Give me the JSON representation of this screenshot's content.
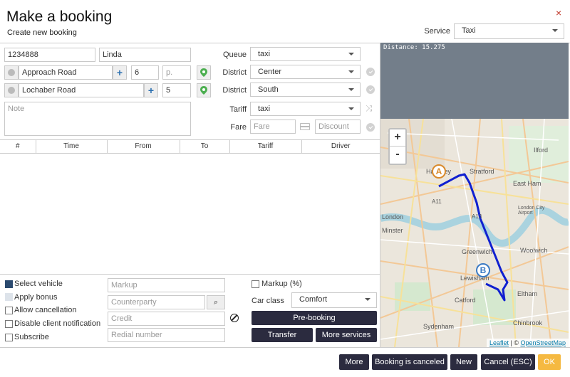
{
  "header": {
    "title": "Make a booking",
    "subtitle": "Create new booking",
    "close": "×"
  },
  "service": {
    "label": "Service",
    "value": "Taxi"
  },
  "client": {
    "phone": "1234888",
    "name": "Linda"
  },
  "pickup": {
    "street": "Approach Road",
    "house": "6",
    "apt_placeholder": "p."
  },
  "dropoff": {
    "street": "Lochaber Road",
    "house": "5"
  },
  "note_placeholder": "Note",
  "queue": {
    "label": "Queue",
    "value": "taxi"
  },
  "district1": {
    "label": "District",
    "value": "Center"
  },
  "district2": {
    "label": "District",
    "value": "South"
  },
  "tariff": {
    "label": "Tariff",
    "value": "taxi"
  },
  "fare": {
    "label": "Fare",
    "placeholder": "Fare",
    "discount_placeholder": "Discount"
  },
  "table": {
    "columns": [
      "#",
      "Time",
      "From",
      "To",
      "Tariff",
      "Driver"
    ]
  },
  "options": {
    "select_vehicle": "Select vehicle",
    "apply_bonus": "Apply bonus",
    "allow_cancellation": "Allow cancellation",
    "disable_notification": "Disable client notification",
    "subscribe": "Subscribe"
  },
  "middle_inputs": {
    "markup": "Markup",
    "counterparty": "Counterparty",
    "credit": "Credit",
    "redial": "Redial number"
  },
  "right_opts": {
    "markup_pct": "Markup (%)",
    "car_class_label": "Car class",
    "car_class_value": "Comfort",
    "prebooking": "Pre-booking",
    "transfer": "Transfer",
    "more_services": "More services"
  },
  "map": {
    "distance": "Distance: 15.275",
    "zoom_in": "+",
    "zoom_out": "-",
    "marker_a": "A",
    "marker_b": "B",
    "attrib_leaflet": "Leaflet",
    "attrib_sep": " | © ",
    "attrib_osm": "OpenStreetMap",
    "places": [
      "Ilford",
      "Stratford",
      "East Ham",
      "A11",
      "A13",
      "London City Airport",
      "Greenwich",
      "Woolwich",
      "Lewisham",
      "Eltham",
      "Catford",
      "Chinbrook",
      "Sydenham",
      "Hackney",
      "London",
      "Minster"
    ]
  },
  "footer": {
    "more": "More",
    "canceled": "Booking is canceled",
    "new": "New",
    "cancel": "Cancel (ESC)",
    "ok": "OK"
  },
  "colors": {
    "dark_button": "#2b2b3f",
    "ok_button": "#f5b941",
    "route": "#1020d0",
    "marker_a": "#d98a2b",
    "marker_b": "#3b7bc4"
  }
}
